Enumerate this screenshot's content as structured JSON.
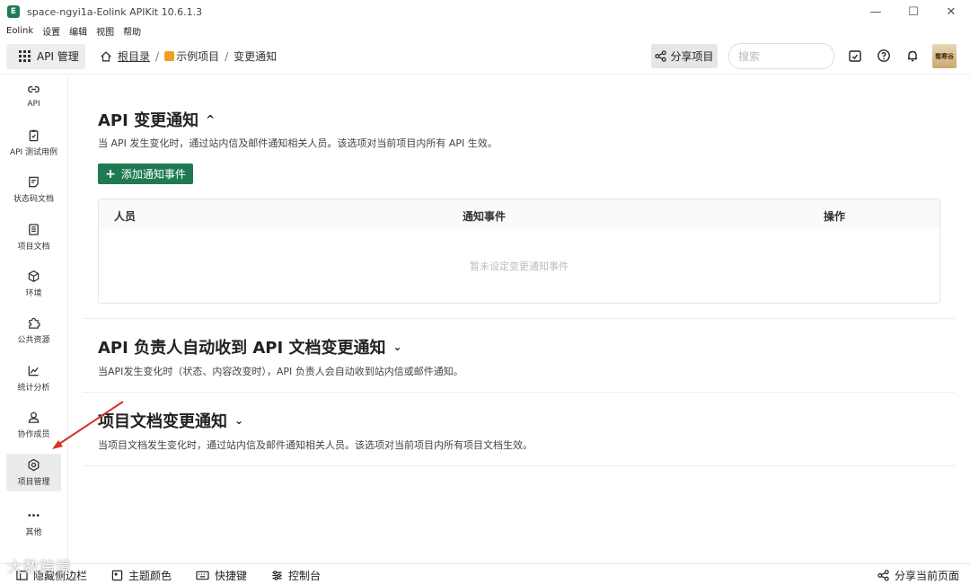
{
  "window": {
    "title": "space-ngyi1a-Eolink APIKit 10.6.1.3",
    "logo_letter": "E",
    "controls": {
      "minimize": "—",
      "maximize": "☐",
      "close": "✕"
    }
  },
  "menu": [
    "Eolink",
    "设置",
    "编辑",
    "视图",
    "帮助"
  ],
  "topbar": {
    "api_mgmt_label": "API 管理",
    "breadcrumb": {
      "root": "根目录",
      "sep": "/",
      "project": "示例项目",
      "page": "变更通知"
    },
    "share_project_label": "分享项目",
    "search_placeholder": "搜索",
    "avatar_text": "蜀寒谷"
  },
  "sidebar": {
    "items": [
      {
        "label": "API",
        "icon": "link-icon"
      },
      {
        "label": "API 测试用例",
        "icon": "clipboard-check-icon"
      },
      {
        "label": "状态码文档",
        "icon": "note-icon"
      },
      {
        "label": "项目文档",
        "icon": "document-icon"
      },
      {
        "label": "环境",
        "icon": "cube-icon"
      },
      {
        "label": "公共资源",
        "icon": "puzzle-icon"
      },
      {
        "label": "统计分析",
        "icon": "chart-icon"
      },
      {
        "label": "协作成员",
        "icon": "user-icon"
      },
      {
        "label": "项目管理",
        "icon": "gear-icon"
      },
      {
        "label": "其他",
        "icon": "more-icon"
      }
    ]
  },
  "sections": [
    {
      "title": "API 变更通知",
      "chevron": "^",
      "description": "当 API 发生变化时，通过站内信及邮件通知相关人员。该选项对当前项目内所有 API 生效。",
      "add_button": "添加通知事件",
      "table": {
        "headers": [
          "人员",
          "通知事件",
          "操作"
        ],
        "empty": "暂未设定变更通知事件"
      }
    },
    {
      "title": "API 负责人自动收到 API 文档变更通知",
      "chevron": "⌄",
      "description": "当API发生变化时（状态、内容改变时），API 负责人会自动收到站内信或邮件通知。"
    },
    {
      "title": "项目文档变更通知",
      "chevron": "⌄",
      "description": "当项目文档发生变化时，通过站内信及邮件通知相关人员。该选项对当前项目内所有项目文档生效。"
    }
  ],
  "footer": {
    "hide_sidebar": "隐藏侧边栏",
    "theme_color": "主题颜色",
    "shortcuts": "快捷键",
    "console": "控制台",
    "share_page": "分享当前页面",
    "watermark": "大数跨境"
  },
  "colors": {
    "accent": "#1f7a52",
    "annotation_arrow": "#d93025"
  }
}
